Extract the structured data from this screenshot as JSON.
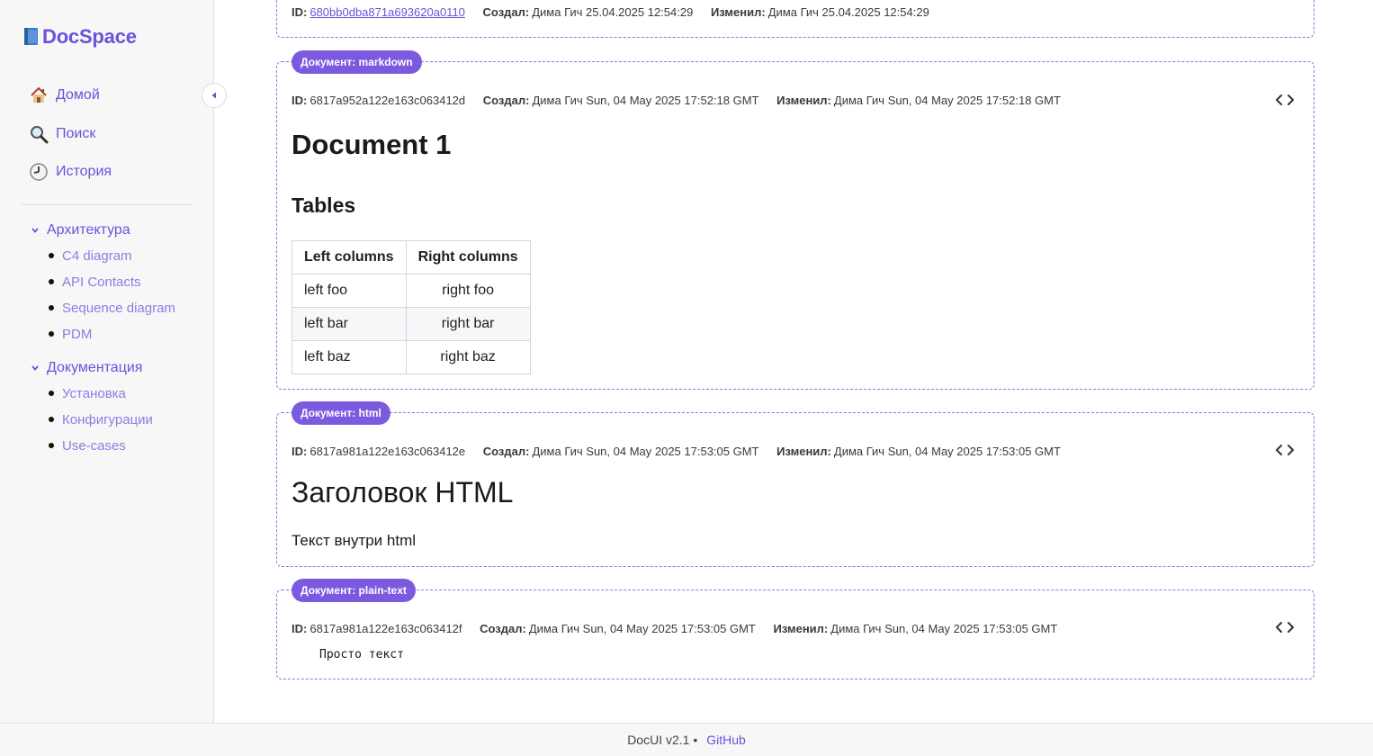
{
  "brand": {
    "name": "DocSpace"
  },
  "nav": [
    {
      "label": "Домой",
      "icon": "house-icon"
    },
    {
      "label": "Поиск",
      "icon": "magnifier-icon"
    },
    {
      "label": "История",
      "icon": "clock-icon"
    }
  ],
  "tree": [
    {
      "label": "Архитектура",
      "items": [
        "C4 diagram",
        "API Contacts",
        "Sequence diagram",
        "PDM"
      ]
    },
    {
      "label": "Документация",
      "items": [
        "Установка",
        "Конфигурации",
        "Use-cases"
      ]
    }
  ],
  "meta_labels": {
    "id": "ID:",
    "created": "Создал:",
    "modified": "Изменил:"
  },
  "top_card": {
    "id": "680bb0dba871a693620a0110",
    "created": "Дима Гич 25.04.2025 12:54:29",
    "modified": "Дима Гич 25.04.2025 12:54:29"
  },
  "doc_markdown": {
    "tag": "Документ: markdown",
    "id": "6817a952a122e163c063412d",
    "created": "Дима Гич Sun, 04 May 2025 17:52:18 GMT",
    "modified": "Дима Гич Sun, 04 May 2025 17:52:18 GMT",
    "h1": "Document 1",
    "h2": "Tables",
    "table": {
      "headers": [
        "Left columns",
        "Right columns"
      ],
      "rows": [
        [
          "left foo",
          "right foo"
        ],
        [
          "left bar",
          "right bar"
        ],
        [
          "left baz",
          "right baz"
        ]
      ]
    }
  },
  "doc_html": {
    "tag": "Документ: html",
    "id": "6817a981a122e163c063412e",
    "created": "Дима Гич Sun, 04 May 2025 17:53:05 GMT",
    "modified": "Дима Гич Sun, 04 May 2025 17:53:05 GMT",
    "heading": "Заголовок HTML",
    "text": "Текст внутри html"
  },
  "doc_plain": {
    "tag": "Документ: plain-text",
    "id": "6817a981a122e163c063412f",
    "created": "Дима Гич Sun, 04 May 2025 17:53:05 GMT",
    "modified": "Дима Гич Sun, 04 May 2025 17:53:05 GMT",
    "text": "Просто текст"
  },
  "footer": {
    "version": "DocUI v2.1 •",
    "link": "GitHub"
  },
  "colors": {
    "accent": "#6c52d9",
    "tag_bg": "#7c5ae0",
    "dashed_border": "#8a7bd8"
  }
}
